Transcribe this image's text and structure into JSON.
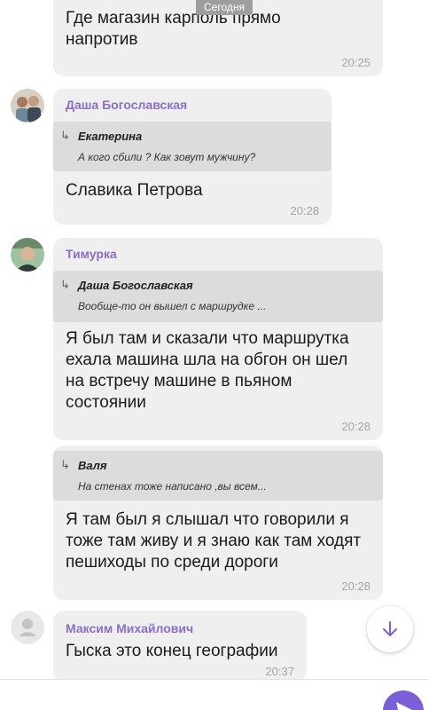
{
  "date_chip": "Сегодня",
  "messages": [
    {
      "text": "Где магазин карполь прямо напротив",
      "time": "20:25"
    },
    {
      "sender": "Даша Богославская",
      "quote": {
        "name": "Екатерина",
        "text": "А кого сбили ? Как зовут мужчину?"
      },
      "text": "Славика Петрова",
      "time": "20:28"
    },
    {
      "sender": "Тимурка",
      "quote": {
        "name": "Даша Богославская",
        "text": "Вообще-то он вышел с маршрудке ..."
      },
      "text": "Я был там и сказали что маршрутка ехала машина шла на обгон он шел на встречу машине в пьяном состоянии",
      "time": "20:28"
    },
    {
      "quote": {
        "name": "Валя",
        "text": "На стенах тоже написано ,вы всем..."
      },
      "text": "Я там был я слышал что говорили я тоже там живу и я знаю как там ходят пешиходы по среди дороги",
      "time": "20:28"
    },
    {
      "sender": "Максим Михайлович",
      "text": "Гыска это конец географии",
      "time": "20:37"
    }
  ],
  "colors": {
    "accent": "#7b5fd6",
    "sender_name": "#8a6fc2",
    "bubble": "#efeff0",
    "quote_bg": "#dcdcdd"
  },
  "icons": {
    "reply": "reply-arrow-icon",
    "scroll": "arrow-down-icon",
    "send": "send-icon",
    "avatar_placeholder": "user-icon"
  }
}
